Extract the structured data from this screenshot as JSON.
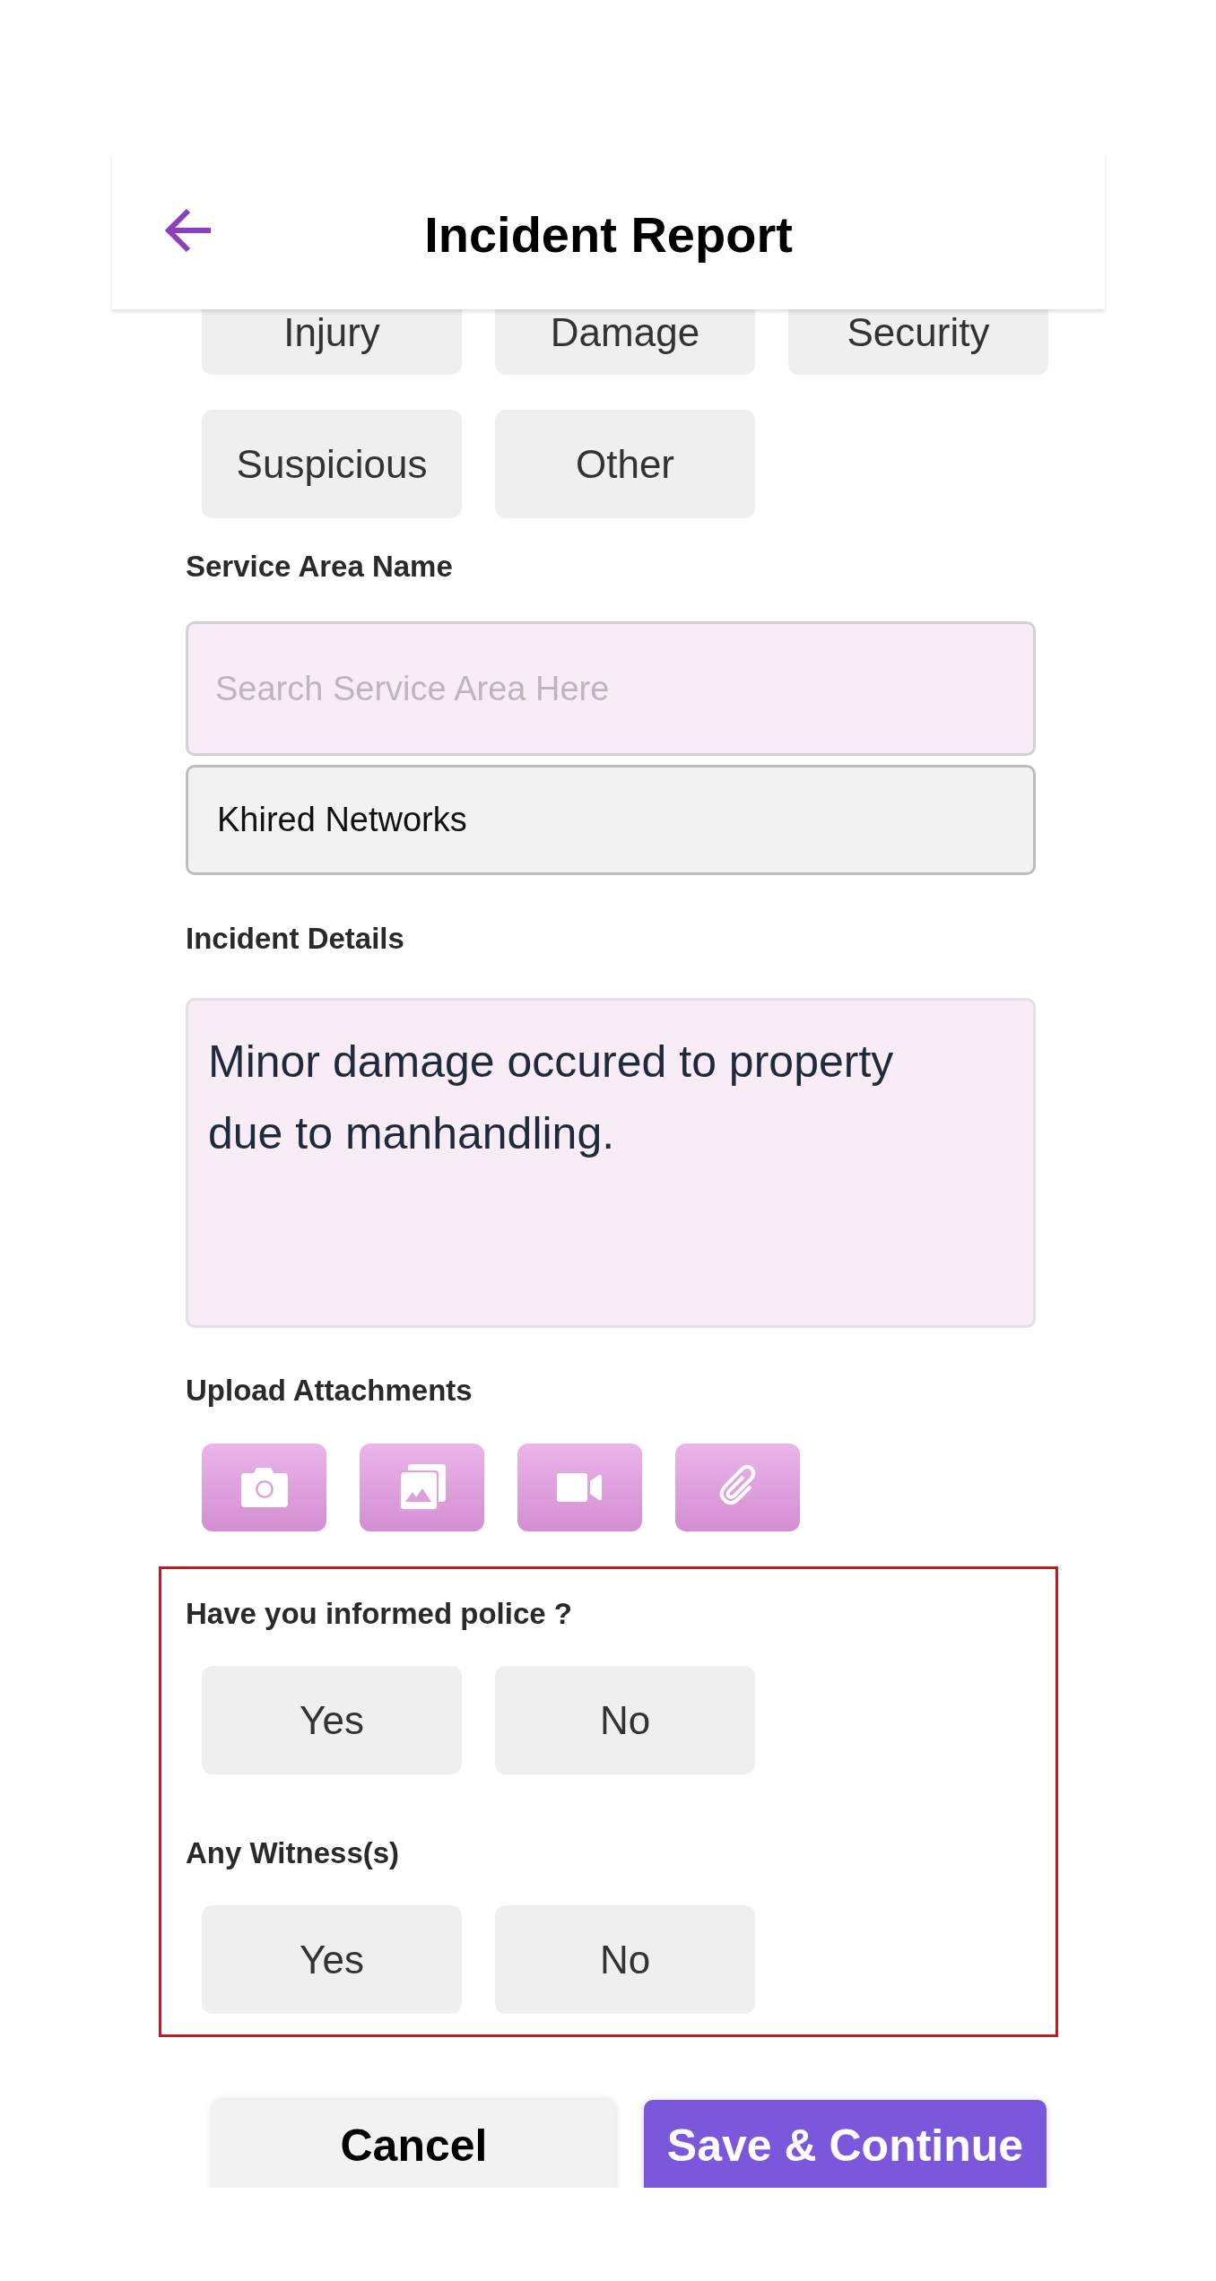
{
  "header": {
    "title": "Incident Report"
  },
  "incident_types": [
    {
      "label": "Injury",
      "selected": false
    },
    {
      "label": "Damage",
      "selected": false
    },
    {
      "label": "Security",
      "selected": false
    },
    {
      "label": "Suspicious",
      "selected": false
    },
    {
      "label": "Other",
      "selected": false
    }
  ],
  "service_area": {
    "label": "Service Area Name",
    "search": {
      "placeholder": "Search Service Area Here"
    },
    "selected_area": "Khired Networks"
  },
  "incident_details": {
    "label": "Incident Details",
    "value": "Minor damage occured to property due to manhandling."
  },
  "attachments": {
    "label": "Upload Attachments",
    "buttons": [
      {
        "kind": "camera"
      },
      {
        "kind": "gallery"
      },
      {
        "kind": "video"
      },
      {
        "kind": "file"
      }
    ]
  },
  "questions_section": {
    "highlighted": true,
    "questions": [
      {
        "label": "Have you informed police ?",
        "options": [
          {
            "label": "Yes",
            "selected": false
          },
          {
            "label": "No",
            "selected": false
          }
        ]
      },
      {
        "label": "Any Witness(s)",
        "options": [
          {
            "label": "Yes",
            "selected": false
          },
          {
            "label": "No",
            "selected": false
          }
        ]
      }
    ]
  },
  "actions": [
    {
      "kind": "secondary",
      "label": "Cancel"
    },
    {
      "kind": "primary",
      "label": "Save & Continue"
    }
  ]
}
